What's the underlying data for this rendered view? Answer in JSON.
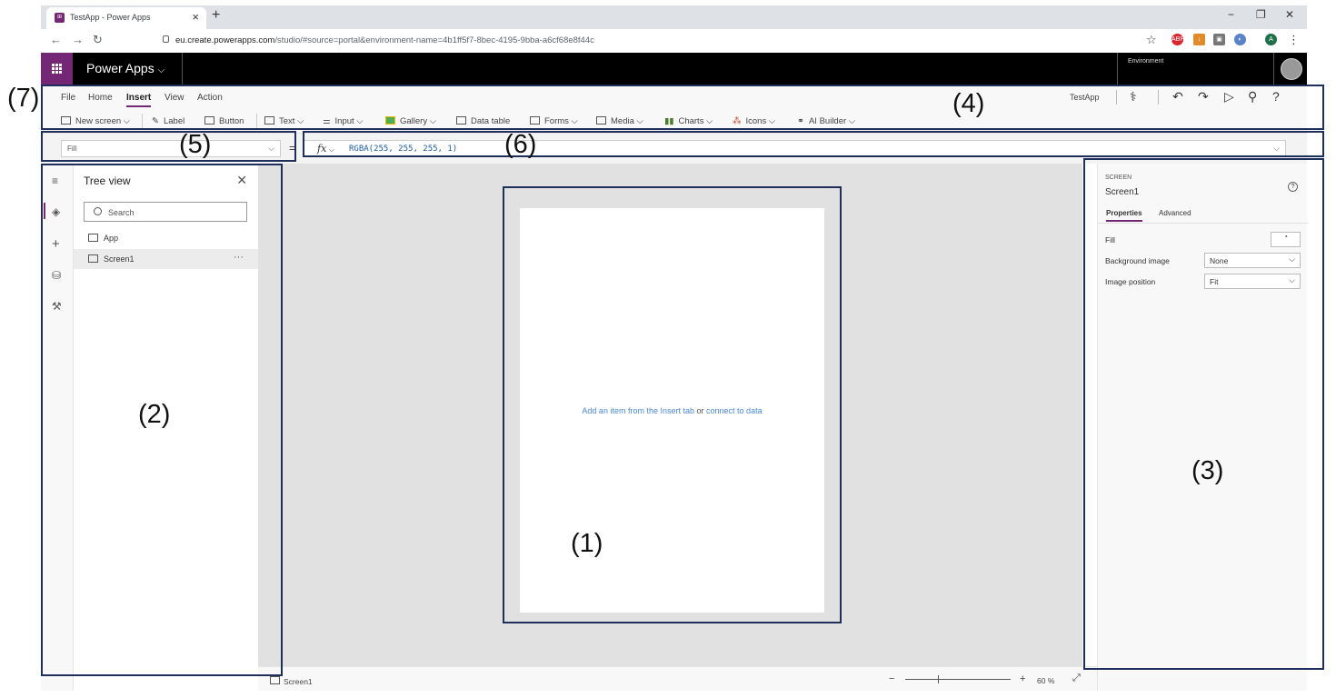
{
  "browser": {
    "tab_title": "TestApp - Power Apps",
    "url_host": "eu.create.powerapps.com",
    "url_path": "/studio/#source=portal&environment-name=4b1ff5f7-8bec-4195-9bba-a6cf68e8f44c",
    "profile_initial": "A"
  },
  "app": {
    "title": "Power Apps",
    "environment_label": "Environment"
  },
  "ribbon": {
    "menu": [
      "File",
      "Home",
      "Insert",
      "View",
      "Action"
    ],
    "active_menu": "Insert",
    "app_name": "TestApp",
    "insert_items": [
      "New screen",
      "Label",
      "Button",
      "Text",
      "Input",
      "Gallery",
      "Data table",
      "Forms",
      "Media",
      "Charts",
      "Icons",
      "AI Builder"
    ]
  },
  "formula_bar": {
    "property": "Fill",
    "equals": "=",
    "fx": "fx",
    "formula": "RGBA(255, 255, 255, 1)"
  },
  "tree_view": {
    "title": "Tree view",
    "search_placeholder": "Search",
    "items": [
      "App",
      "Screen1"
    ],
    "more": "···"
  },
  "canvas": {
    "hint_link1": "Add an item from the Insert tab",
    "hint_or": "or",
    "hint_link2": "connect to data"
  },
  "status_bar": {
    "screen": "Screen1",
    "zoom_minus": "−",
    "zoom_plus": "+",
    "zoom": "60 %"
  },
  "properties": {
    "type": "SCREEN",
    "name": "Screen1",
    "help": "?",
    "tabs": [
      "Properties",
      "Advanced"
    ],
    "fill_label": "Fill",
    "background_image_label": "Background image",
    "background_image_value": "None",
    "image_position_label": "Image position",
    "image_position_value": "Fit"
  },
  "annotations": [
    "(1)",
    "(2)",
    "(3)",
    "(4)",
    "(5)",
    "(6)",
    "(7)"
  ],
  "colors": {
    "accent": "#742774",
    "annotation_border": "#1f2f5c",
    "link": "#4b8bd4"
  }
}
